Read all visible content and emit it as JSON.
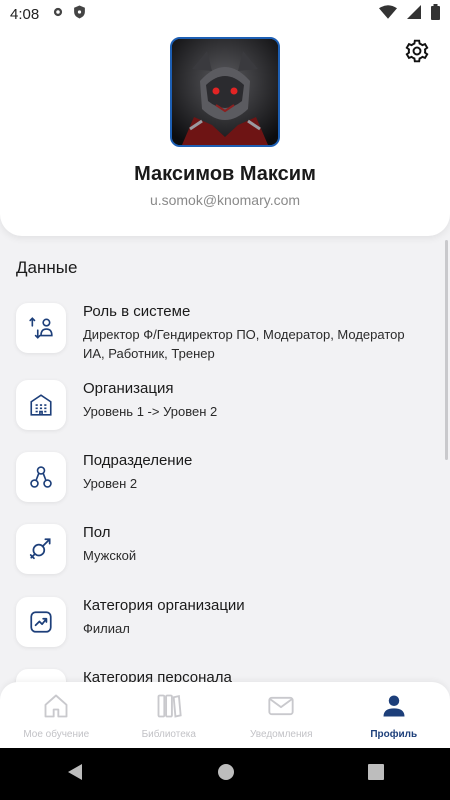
{
  "status_bar": {
    "time": "4:08"
  },
  "profile": {
    "name": "Максимов Максим",
    "email": "u.somok@knomary.com"
  },
  "section": {
    "title": "Данные"
  },
  "info": [
    {
      "label": "Роль в системе",
      "value": "Директор Ф/Гендиректор ПО, Модератор, Модератор ИА, Работник, Тренер",
      "icon": "role-sort-icon"
    },
    {
      "label": "Организация",
      "value": "Уровень 1 -> Уровен 2",
      "icon": "building-icon"
    },
    {
      "label": "Подразделение",
      "value": "Уровен 2",
      "icon": "hierarchy-icon"
    },
    {
      "label": "Пол",
      "value": "Мужской",
      "icon": "gender-icon"
    },
    {
      "label": "Категория организации",
      "value": "Филиал",
      "icon": "trend-chart-icon"
    },
    {
      "label": "Категория персонала",
      "value": "",
      "icon": "personnel-icon"
    }
  ],
  "bottom_nav": [
    {
      "label": "Мое обучение",
      "icon": "home-icon",
      "active": false
    },
    {
      "label": "Библиотека",
      "icon": "library-icon",
      "active": false
    },
    {
      "label": "Уведомления",
      "icon": "mail-icon",
      "active": false
    },
    {
      "label": "Профиль",
      "icon": "user-icon",
      "active": true
    }
  ],
  "colors": {
    "accent": "#1d5fb4",
    "active_nav": "#1d3f7a",
    "inactive_nav": "#c2c2c6",
    "background": "#f2f2f4"
  }
}
